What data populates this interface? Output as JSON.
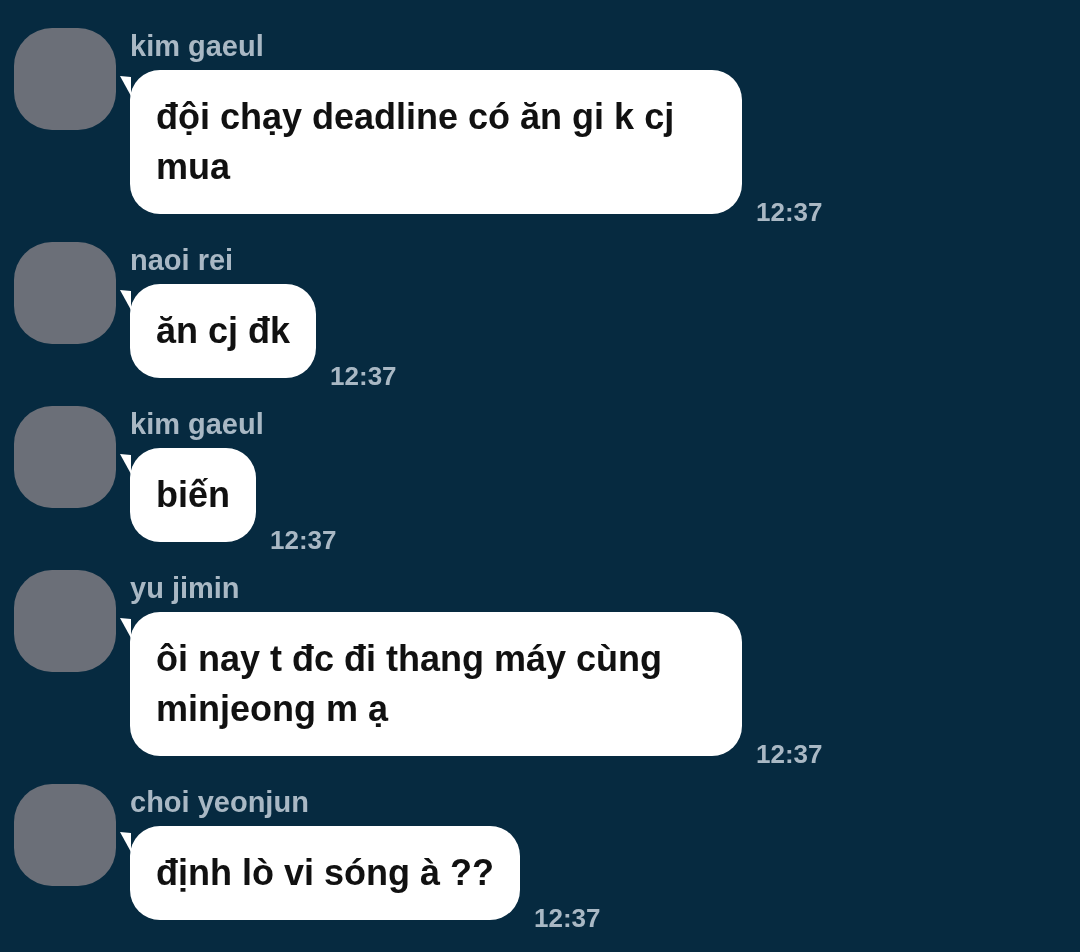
{
  "messages": [
    {
      "sender": "kim gaeul",
      "text": "đội chạy deadline có ăn gi k cj mua",
      "time": "12:37"
    },
    {
      "sender": "naoi rei",
      "text": "ăn cj đk",
      "time": "12:37"
    },
    {
      "sender": "kim gaeul",
      "text": "biến",
      "time": "12:37"
    },
    {
      "sender": "yu jimin",
      "text": "ôi nay t đc đi thang máy cùng minjeong m ạ",
      "time": "12:37"
    },
    {
      "sender": "choi yeonjun",
      "text": "định lò vi sóng à ??",
      "time": "12:37"
    }
  ]
}
